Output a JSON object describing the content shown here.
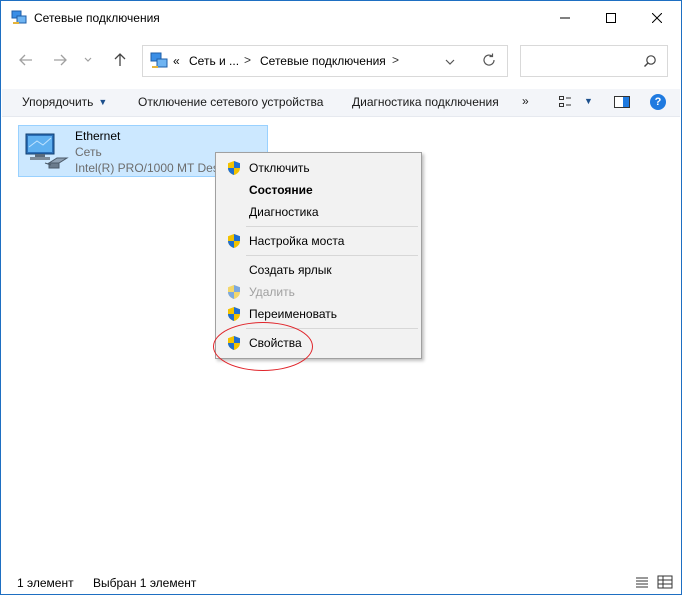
{
  "window": {
    "title": "Сетевые подключения"
  },
  "address_bar": {
    "overflow": "«",
    "segments": [
      "Сеть и ...",
      "Сетевые подключения"
    ],
    "separator": ">"
  },
  "toolbar": {
    "organize": "Упорядочить",
    "disable_device": "Отключение сетевого устройства",
    "diagnose": "Диагностика подключения",
    "more": "»",
    "help": "?"
  },
  "connection": {
    "name": "Ethernet",
    "network": "Сеть",
    "adapter": "Intel(R) PRO/1000 MT Desk"
  },
  "context_menu": {
    "items": [
      {
        "label": "Отключить",
        "shield": true,
        "style": "normal"
      },
      {
        "label": "Состояние",
        "shield": false,
        "style": "bold"
      },
      {
        "label": "Диагностика",
        "shield": false,
        "style": "normal"
      },
      {
        "label": "Настройка моста",
        "shield": true,
        "style": "normal"
      },
      {
        "label": "Создать ярлык",
        "shield": false,
        "style": "normal"
      },
      {
        "label": "Удалить",
        "shield": true,
        "style": "disabled"
      },
      {
        "label": "Переименовать",
        "shield": true,
        "style": "normal"
      },
      {
        "label": "Свойства",
        "shield": true,
        "style": "normal"
      }
    ],
    "highlight_color": "#e0242a"
  },
  "status_bar": {
    "count": "1 элемент",
    "selected": "Выбран 1 элемент"
  },
  "colors": {
    "selection_bg": "#cce8ff",
    "selection_border": "#99d1ff",
    "accent": "#1f7ae0"
  },
  "icons": [
    "network-connections-icon",
    "back-arrow-icon",
    "forward-arrow-icon",
    "chevron-down-icon",
    "up-arrow-icon",
    "refresh-icon",
    "search-icon",
    "view-options-icon",
    "preview-pane-icon",
    "help-icon",
    "ethernet-adapter-icon",
    "uac-shield-icon",
    "details-view-icon",
    "large-icons-view-icon"
  ]
}
